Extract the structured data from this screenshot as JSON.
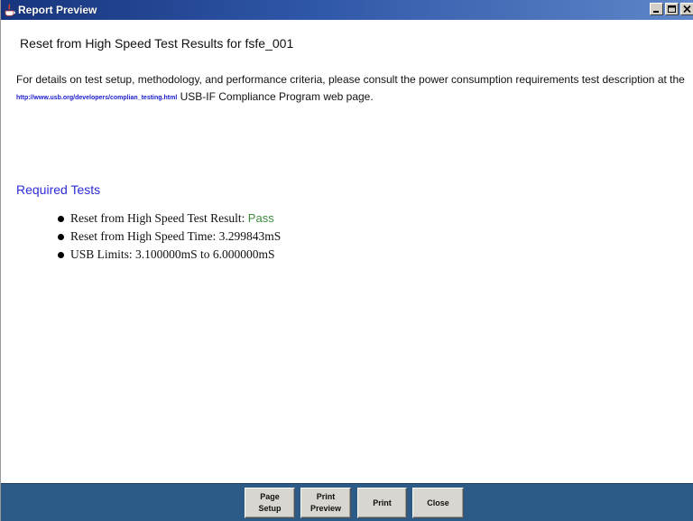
{
  "window": {
    "title": "Report Preview",
    "controls": [
      "minimize-icon",
      "maximize-icon",
      "close-icon"
    ]
  },
  "report": {
    "title": "Reset from High Speed Test Results for fsfe_001",
    "intro_before_link": "For details on test setup, methodology, and performance criteria, please consult the power consumption requirements test description at the ",
    "link": "http://www.usb.org/developers/complian_testing.html",
    "intro_after_link": " USB-IF Compliance Program web page.",
    "section_heading": "Required Tests",
    "tests": [
      {
        "label": "Reset from High Speed Test Result: ",
        "value": "Pass"
      },
      {
        "label": "Reset from High Speed Time: 3.299843mS",
        "value": ""
      },
      {
        "label": "USB Limits: 3.100000mS to 6.000000mS",
        "value": ""
      }
    ]
  },
  "buttons": {
    "page_setup_line1": "Page",
    "page_setup_line2": "Setup",
    "print_preview_line1": "Print",
    "print_preview_line2": "Preview",
    "print": "Print",
    "close": "Close"
  },
  "colors": {
    "titlebar": "#17357e",
    "bottombar": "#2d5b87",
    "link": "#1a1acc",
    "heading": "#2b2bd9",
    "pass": "#3c8a3c"
  }
}
